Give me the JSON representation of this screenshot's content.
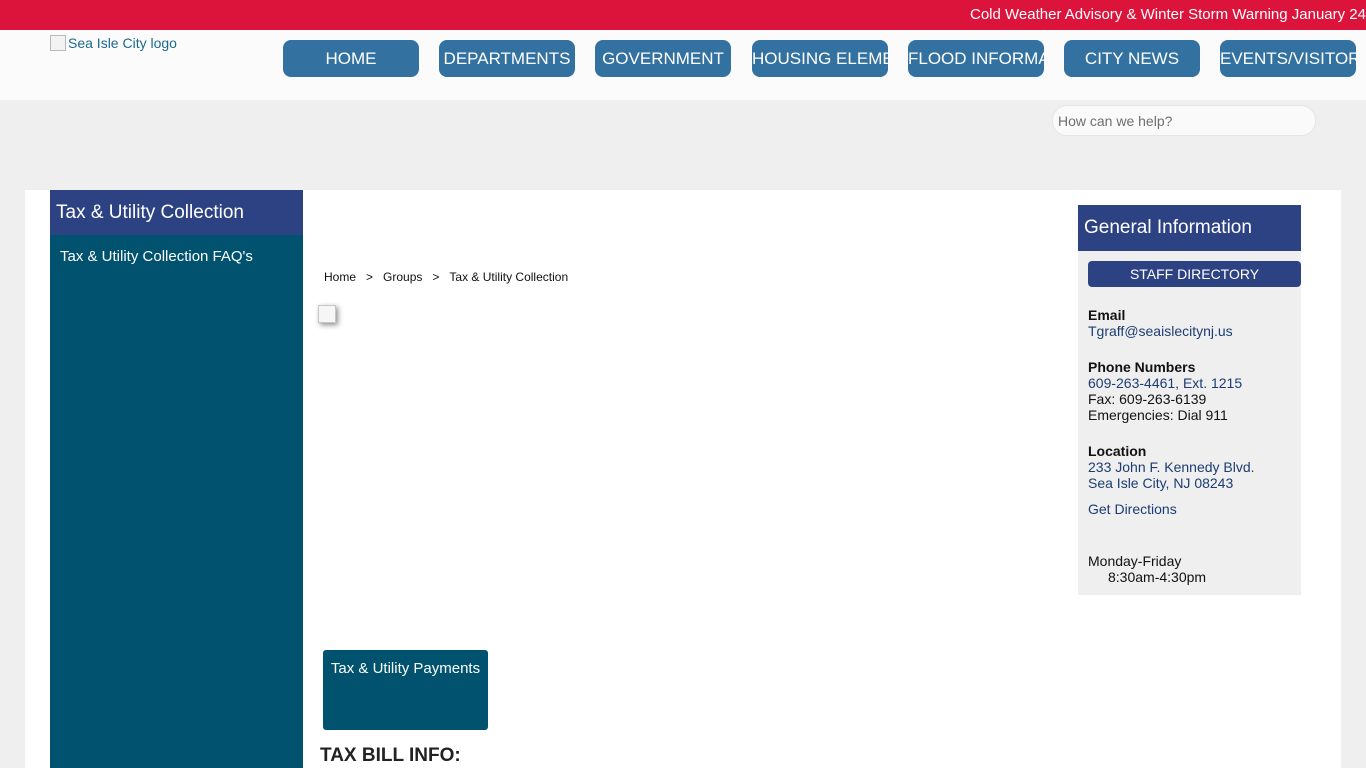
{
  "alert": {
    "text": "Cold Weather Advisory & Winter Storm Warning January 24"
  },
  "header": {
    "logo_alt": "Sea Isle City logo",
    "nav": [
      {
        "label": "HOME"
      },
      {
        "label": "DEPARTMENTS"
      },
      {
        "label": "GOVERNMENT"
      },
      {
        "label": "HOUSING ELEMENT"
      },
      {
        "label": "FLOOD INFORMATION"
      },
      {
        "label": "CITY NEWS"
      },
      {
        "label": "EVENTS/VISITOR"
      }
    ],
    "nav_color": "#3372a0"
  },
  "search": {
    "placeholder": "How can we help?"
  },
  "sidebar": {
    "title": "Tax & Utility Collection",
    "items": [
      {
        "label": "Tax & Utility Collection FAQ's"
      }
    ],
    "colors": {
      "title_bg": "#2d4282",
      "body_bg": "#00526f"
    }
  },
  "breadcrumb": {
    "items": [
      "Home",
      "Groups",
      "Tax & Utility Collection"
    ],
    "separator": ">"
  },
  "main": {
    "payment_tile": "Tax & Utility Payments",
    "section_heading": "TAX BILL INFO:"
  },
  "info": {
    "title": "General Information",
    "staff_directory": "STAFF DIRECTORY",
    "email_label": "Email",
    "email": "Tgraff@seaislecitynj.us",
    "phone_label": "Phone Numbers",
    "phone": "609-263-4461, Ext. 1215",
    "fax": "Fax: 609-263-6139",
    "emergency": "Emergencies: Dial 911",
    "location_label": "Location",
    "address_line1": "233 John F. Kennedy Blvd.",
    "address_line2": "Sea Isle City, NJ 08243",
    "directions": "Get Directions",
    "hours_days": "Monday-Friday",
    "hours_time": "8:30am-4:30pm"
  },
  "colors": {
    "alert_bg": "#dc143c",
    "accent_navy": "#2d4282",
    "accent_teal": "#00526f",
    "link": "#1c3d72"
  }
}
